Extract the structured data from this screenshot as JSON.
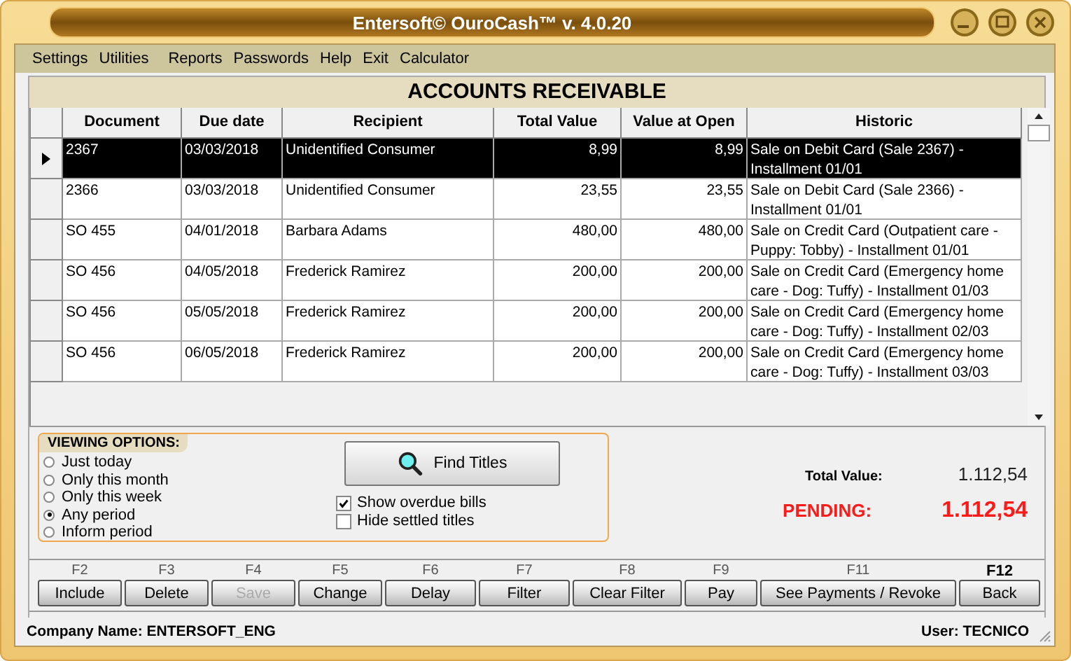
{
  "window": {
    "title": "Entersoft© OuroCash™ v. 4.0.20"
  },
  "menu": [
    {
      "label": "Settings"
    },
    {
      "label": "Utilities"
    },
    {
      "label": "Reports"
    },
    {
      "label": "Passwords"
    },
    {
      "label": "Help"
    },
    {
      "label": "Exit"
    },
    {
      "label": "Calculator"
    }
  ],
  "heading": "ACCOUNTS RECEIVABLE",
  "table": {
    "columns": [
      "Document",
      "Due date",
      "Recipient",
      "Total Value",
      "Value at Open",
      "Historic"
    ],
    "rows": [
      {
        "selected": true,
        "cells": [
          "2367",
          "03/03/2018",
          "Unidentified Consumer",
          "8,99",
          "8,99",
          "Sale on Debit Card (Sale 2367) - Installment 01/01"
        ]
      },
      {
        "selected": false,
        "cells": [
          "2366",
          "03/03/2018",
          "Unidentified Consumer",
          "23,55",
          "23,55",
          "Sale on Debit Card (Sale 2366) - Installment 01/01"
        ]
      },
      {
        "selected": false,
        "cells": [
          "SO 455",
          "04/01/2018",
          "Barbara Adams",
          "480,00",
          "480,00",
          "Sale on Credit Card (Outpatient care - Puppy: Tobby) - Installment 01/01"
        ]
      },
      {
        "selected": false,
        "cells": [
          "SO 456",
          "04/05/2018",
          "Frederick Ramirez",
          "200,00",
          "200,00",
          "Sale on Credit Card (Emergency home care - Dog: Tuffy) - Installment 01/03"
        ]
      },
      {
        "selected": false,
        "cells": [
          "SO 456",
          "05/05/2018",
          "Frederick Ramirez",
          "200,00",
          "200,00",
          "Sale on Credit Card (Emergency home care - Dog: Tuffy) - Installment 02/03"
        ]
      },
      {
        "selected": false,
        "cells": [
          "SO 456",
          "06/05/2018",
          "Frederick Ramirez",
          "200,00",
          "200,00",
          "Sale on Credit Card (Emergency home care - Dog: Tuffy) - Installment 03/03"
        ]
      }
    ]
  },
  "viewing_options": {
    "title": "VIEWING OPTIONS:",
    "options": [
      {
        "label": "Just today",
        "selected": false
      },
      {
        "label": "Only this month",
        "selected": false
      },
      {
        "label": "Only this week",
        "selected": false
      },
      {
        "label": "Any period",
        "selected": true
      },
      {
        "label": "Inform period",
        "selected": false
      }
    ]
  },
  "find_button": "Find Titles",
  "checkboxes": [
    {
      "label": "Show overdue bills",
      "checked": true
    },
    {
      "label": "Hide settled titles",
      "checked": false
    }
  ],
  "totals": {
    "total_label": "Total Value:",
    "total_value": "1.112,54",
    "pending_label": "PENDING:",
    "pending_value": "1.112,54"
  },
  "buttons": [
    {
      "key": "F2",
      "label": "Include",
      "disabled": false,
      "key_bold": false
    },
    {
      "key": "F3",
      "label": "Delete",
      "disabled": false,
      "key_bold": false
    },
    {
      "key": "F4",
      "label": "Save",
      "disabled": true,
      "key_bold": false
    },
    {
      "key": "F5",
      "label": "Change",
      "disabled": false,
      "key_bold": false
    },
    {
      "key": "F6",
      "label": "Delay",
      "disabled": false,
      "key_bold": false
    },
    {
      "key": "F7",
      "label": "Filter",
      "disabled": false,
      "key_bold": false
    },
    {
      "key": "F8",
      "label": "Clear Filter",
      "disabled": false,
      "key_bold": false
    },
    {
      "key": "F9",
      "label": "Pay",
      "disabled": false,
      "key_bold": false
    },
    {
      "key": "F11",
      "label": "See Payments / Revoke",
      "disabled": false,
      "key_bold": false
    },
    {
      "key": "F12",
      "label": "Back",
      "disabled": false,
      "key_bold": true
    }
  ],
  "status_bar": {
    "company": "Company Name: ENTERSOFT_ENG",
    "user": "User: TECNICO"
  }
}
